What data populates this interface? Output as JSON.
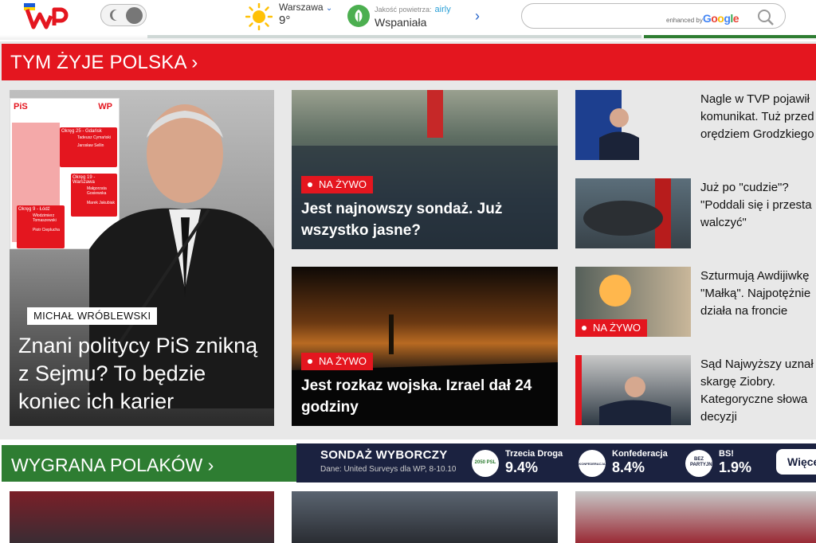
{
  "header": {
    "weather": {
      "city": "Warszawa",
      "temperature": "9°",
      "icon": "sun-icon"
    },
    "air_quality": {
      "label": "Jakość powietrza:",
      "provider": "airly",
      "value": "Wspaniała",
      "icon": "leaf-icon"
    },
    "search": {
      "enhanced_by": "enhanced by",
      "brand": "Google",
      "placeholder": ""
    }
  },
  "section1": {
    "title": "TYM ŻYJE POLSKA ›",
    "featured": {
      "author": "MICHAŁ WRÓBLEWSKI",
      "title": "Znani politycy PiS znikną z Sejmu? To będzie koniec ich karier",
      "graphic": {
        "party": "PiS",
        "brand": "WP",
        "districts": [
          "Okręg 25 - Gdańsk",
          "Okręg 19 - Warszawa",
          "Okręg 9 - Łódź"
        ],
        "names": [
          "Tadeusz Cymański",
          "Jarosław Sellin",
          "Małgorzata Gosiewska",
          "Marek Jakubiak",
          "Włodzimierz Tomaszewski",
          "Piotr Cieplucha"
        ]
      }
    },
    "middle": [
      {
        "live": "NA ŻYWO",
        "title": "Jest najnowszy sondaż. Już wszystko jasne?"
      },
      {
        "live": "NA ŻYWO",
        "title": "Jest rozkaz wojska. Izrael dał 24 godziny"
      }
    ],
    "side": [
      {
        "lines": [
          "Nagle w TVP pojawił",
          "komunikat. Tuż przed",
          "orędziem Grodzkiego"
        ]
      },
      {
        "lines": [
          "Już po \"cudzie\"?",
          "\"Poddali się i przesta",
          "walczyć\""
        ]
      },
      {
        "live": "NA ŻYWO",
        "lines": [
          "Szturmują Awdijiwkę",
          "\"Małką\". Najpotężnie",
          "działa na froncie"
        ]
      },
      {
        "lines": [
          "Sąd Najwyższy uznał",
          "skargę Ziobry.",
          "Kategoryczne słowa",
          "decyzji"
        ]
      }
    ]
  },
  "section2": {
    "title": "WYGRANA POLAKÓW ›",
    "poll": {
      "title": "SONDAŻ WYBORCZY",
      "source": "Dane: United Surveys dla WP, 8-10.10",
      "parties": [
        {
          "name": "Trzecia Droga",
          "value": "9.4%",
          "icon_text": "2050 PSL"
        },
        {
          "name": "Konfederacja",
          "value": "8.4%",
          "icon_text": "KONFEDERACJA"
        },
        {
          "name": "BS!",
          "value": "1.9%",
          "icon_text": "BEZ PARTYJNI"
        }
      ],
      "more": "Więce"
    }
  }
}
